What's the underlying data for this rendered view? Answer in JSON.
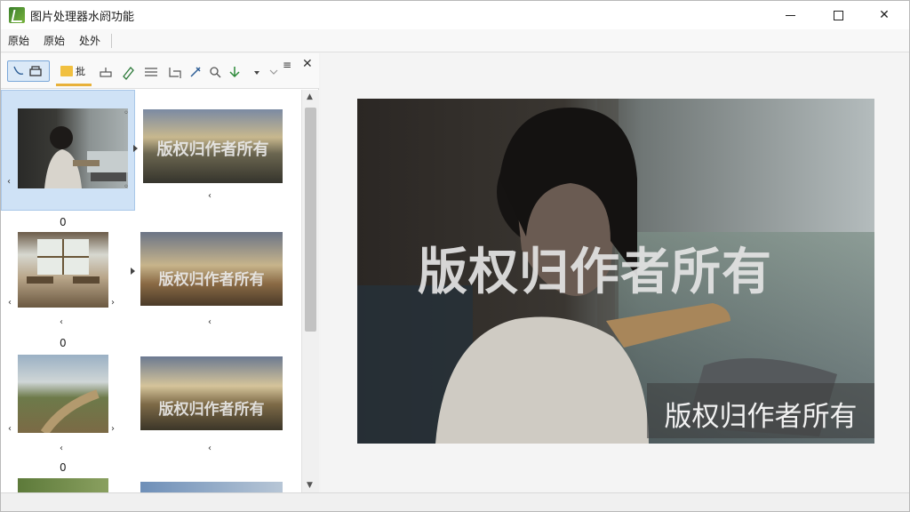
{
  "window": {
    "title": "图片处理器水阏功能",
    "controls": {
      "minimize": "",
      "maximize": "",
      "close": "✕"
    }
  },
  "menu": {
    "items": [
      "原始",
      "原始",
      "处外"
    ]
  },
  "toolbar": {
    "folder_label": "批",
    "more_menu": "≡",
    "close": "✕"
  },
  "thumbnails": {
    "rows": [
      {
        "index": "0",
        "watermark_text": "版权归作者所有",
        "left_arrows": [
          "‹"
        ],
        "right_arrows": [],
        "under": "‹"
      },
      {
        "index": "0",
        "watermark_text": "版权归作者所有",
        "left_arrows": [
          "‹"
        ],
        "right_arrows": [
          "›"
        ],
        "under": "‹"
      },
      {
        "index": "0",
        "watermark_text": "版权归作者所有",
        "left_arrows": [
          "‹"
        ],
        "right_arrows": [
          "›"
        ],
        "under": "‹"
      }
    ]
  },
  "preview": {
    "watermark_large": "版权归作者所有",
    "watermark_small": "版权归作者所有"
  },
  "scrollbar": {
    "up": "▲",
    "down": "▼"
  }
}
